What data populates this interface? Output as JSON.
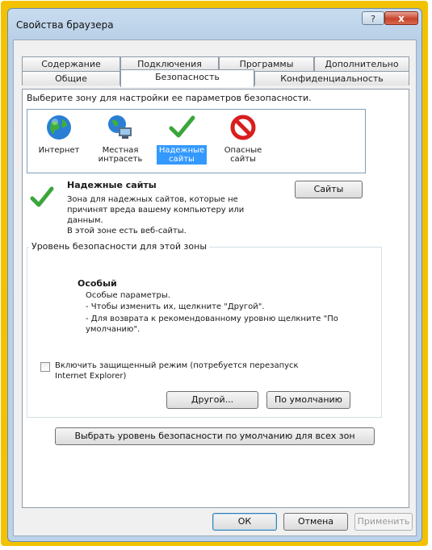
{
  "window": {
    "title": "Свойства браузера",
    "help_label": "?",
    "close_label": "x"
  },
  "tabs": {
    "row1": [
      "Содержание",
      "Подключения",
      "Программы",
      "Дополнительно"
    ],
    "row2": [
      "Общие",
      "Безопасность",
      "Конфиденциальность"
    ],
    "active": "Безопасность"
  },
  "security": {
    "zone_prompt": "Выберите зону для настройки ее параметров безопасности.",
    "zones": [
      {
        "label": "Интернет",
        "icon": "globe-icon"
      },
      {
        "label": "Местная интрасеть",
        "icon": "intranet-icon"
      },
      {
        "label": "Надежные сайты",
        "icon": "checkmark-icon",
        "selected": true
      },
      {
        "label": "Опасные сайты",
        "icon": "restricted-icon"
      }
    ],
    "zone_title": "Надежные сайты",
    "zone_desc": "Зона для надежных сайтов, которые не причинят вреда вашему компьютеру или данным.",
    "zone_note": "В этой зоне есть веб-сайты.",
    "sites_button": "Сайты",
    "level_group_title": "Уровень безопасности для этой зоны",
    "level_name": "Особый",
    "level_desc_1": "Особые параметры.",
    "level_desc_2": "- Чтобы изменить их, щелкните \"Другой\".",
    "level_desc_3": "- Для возврата к рекомендованному уровню щелкните \"По умолчанию\".",
    "protected_mode_label": "Включить защищенный режим (потребуется перезапуск Internet Explorer)",
    "protected_mode_checked": false,
    "custom_button": "Другой...",
    "default_button": "По умолчанию",
    "reset_all_button": "Выбрать уровень безопасности по умолчанию для всех зон"
  },
  "footer": {
    "ok": "ОК",
    "cancel": "Отмена",
    "apply": "Применить"
  },
  "colors": {
    "highlight": "#3399ff",
    "frame": "#f2c200",
    "check_green": "#3aa63a",
    "restricted_red": "#d81e1e"
  }
}
